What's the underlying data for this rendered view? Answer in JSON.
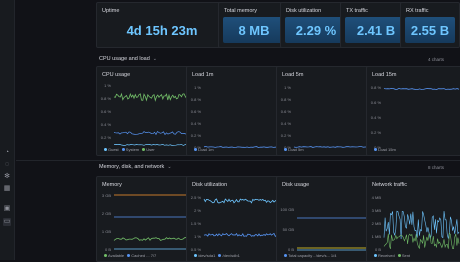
{
  "sidebar": {
    "icons": [
      "bell-icon",
      "chat-icon",
      "gear-icon",
      "grid-icon",
      "dashboard-icon",
      "logo-icon"
    ]
  },
  "stats": {
    "uptime": {
      "label": "Uptime",
      "value": "4d 15h 23m"
    },
    "memory": {
      "label": "Total memory",
      "value": "8 MB"
    },
    "disk": {
      "label": "Disk utilization",
      "value": "2.29 %"
    },
    "tx": {
      "label": "TX traffic",
      "value": "2.41 B"
    },
    "rx": {
      "label": "RX traffic",
      "value": "2.55 B"
    }
  },
  "section1": {
    "title": "CPU usage and load",
    "meta": "4 charts"
  },
  "section2": {
    "title": "Memory, disk, and network",
    "meta": "8 charts"
  },
  "cpu": {
    "title": "CPU usage",
    "ticks": [
      "1 %",
      "0.8 %",
      "0.6 %",
      "0.4 %",
      "0.2 %",
      "0 %"
    ],
    "legend": [
      "Guest",
      "System",
      "User"
    ]
  },
  "load1": {
    "title": "Load 1m",
    "ticks": [
      "1 %",
      "0.8 %",
      "0.6 %",
      "0.4 %",
      "0.2 %",
      "0 %"
    ],
    "legend": "Load 1m"
  },
  "load5": {
    "title": "Load 5m",
    "ticks": [
      "1 %",
      "0.8 %",
      "0.6 %",
      "0.4 %",
      "0.2 %",
      "0 %"
    ],
    "legend": "Load 5m"
  },
  "load15": {
    "title": "Load 15m",
    "ticks": [
      "0.8 %",
      "0.6 %",
      "0.4 %",
      "0.2 %",
      "0 %"
    ],
    "legend": "Load 15m"
  },
  "mem": {
    "title": "Memory",
    "ticks": [
      "3 GB",
      "2 GB",
      "1 GB",
      "0 B"
    ],
    "legend": [
      "Available",
      "Cached",
      "...",
      "7/7"
    ]
  },
  "diskutil": {
    "title": "Disk utilization",
    "ticks": [
      "2.5 %",
      "2 %",
      "1.5 %",
      "1 %",
      "0.5 %"
    ],
    "legend": [
      "/dev/sda1",
      "/dev/sdb1"
    ]
  },
  "diskusage": {
    "title": "Disk usage",
    "ticks": [
      "100 GB",
      "50 GB",
      "0 B"
    ],
    "legend": [
      "Total capacity - /dev/s...",
      "1/4"
    ]
  },
  "net": {
    "title": "Network traffic",
    "ticks": [
      "4 MB",
      "3 MB",
      "2 MB",
      "1 MB",
      "0 B"
    ],
    "legend": [
      "Received",
      "Sent"
    ]
  },
  "colors": {
    "green": "#73bf69",
    "blue": "#5794f2",
    "cyan": "#6ec6ff",
    "orange": "#ff9830",
    "yellow": "#fade2a",
    "accent": "#6ec6ff"
  }
}
